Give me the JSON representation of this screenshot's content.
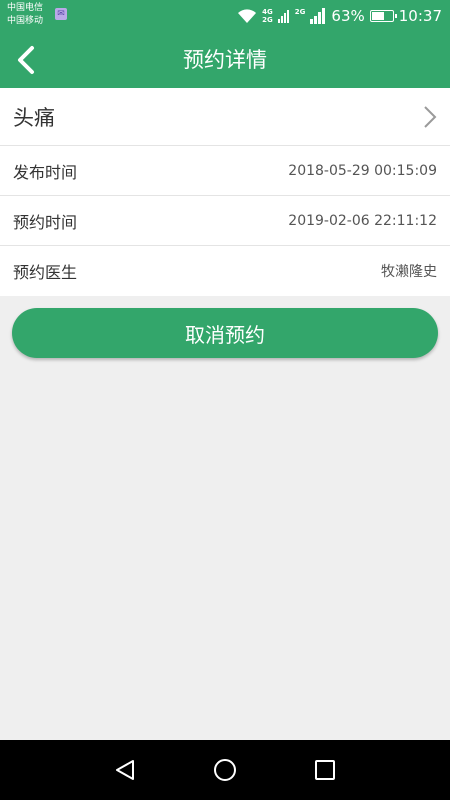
{
  "status_bar": {
    "carrier_1": "中国电信",
    "carrier_2": "中国移动",
    "net_tag_top": "4G",
    "net_tag_bottom": "2G",
    "net_tag_2": "2G",
    "battery_percent": "63%",
    "battery_level": 0.63,
    "time": "10:37"
  },
  "app_bar": {
    "title": "预约详情"
  },
  "detail": {
    "condition": "头痛",
    "rows": [
      {
        "label": "发布时间",
        "value": "2018-05-29 00:15:09"
      },
      {
        "label": "预约时间",
        "value": "2019-02-06 22:11:12"
      },
      {
        "label": "预约医生",
        "value": "牧濑隆史"
      }
    ]
  },
  "actions": {
    "cancel_label": "取消预约"
  },
  "colors": {
    "brand": "#33a66b",
    "background": "#efefef"
  }
}
